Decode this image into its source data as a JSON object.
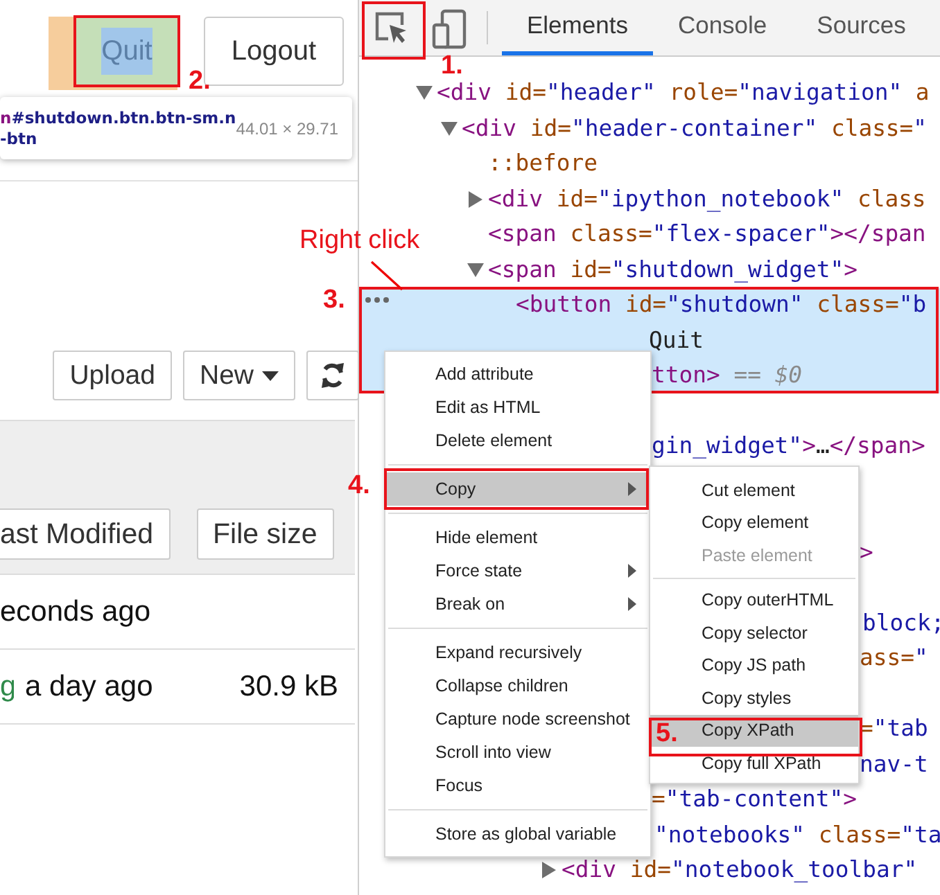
{
  "notebook": {
    "header_buttons": [
      {
        "label": "Quit",
        "inspected": true
      },
      {
        "label": "Logout",
        "inspected": false
      }
    ],
    "tooltip": {
      "tag": "n",
      "selector_lines": [
        "#shutdown.btn.btn-sm.n",
        "-btn"
      ],
      "size": "44.01 × 29.71"
    },
    "toolbar": [
      {
        "kind": "text",
        "label": "Upload"
      },
      {
        "kind": "dropdown",
        "label": "New"
      },
      {
        "kind": "refresh"
      }
    ],
    "list_header": [
      {
        "label": "ast Modified"
      },
      {
        "label": "File size"
      }
    ],
    "rows": [
      {
        "modified": "econds ago"
      },
      {
        "name": "g",
        "modified": "a day ago",
        "size": "30.9 kB"
      }
    ]
  },
  "devtools": {
    "tabs": [
      {
        "label": "Elements",
        "selected": true
      },
      {
        "label": "Console",
        "selected": false
      },
      {
        "label": "Sources",
        "selected": false
      }
    ],
    "lines": [
      {
        "expanded": true,
        "selected": false,
        "tokens": [
          {
            "kind": "tag",
            "text": "<div"
          },
          {
            "kind": "attr",
            "text": " id="
          },
          {
            "kind": "value",
            "text": "\"header\""
          },
          {
            "kind": "attr",
            "text": " role="
          },
          {
            "kind": "value",
            "text": "\"navigation\""
          },
          {
            "kind": "attr",
            "text": " a"
          }
        ]
      },
      {
        "expanded": true,
        "selected": false,
        "tokens": [
          {
            "kind": "tag",
            "text": "<div"
          },
          {
            "kind": "attr",
            "text": " id="
          },
          {
            "kind": "value",
            "text": "\"header-container\""
          },
          {
            "kind": "attr",
            "text": " class="
          },
          {
            "kind": "value",
            "text": "\""
          }
        ]
      },
      {
        "selected": false,
        "tokens": [
          {
            "kind": "pseudo",
            "text": "::before"
          }
        ]
      },
      {
        "expanded": false,
        "selected": false,
        "tokens": [
          {
            "kind": "tag",
            "text": "<div"
          },
          {
            "kind": "attr",
            "text": " id="
          },
          {
            "kind": "value",
            "text": "\"ipython_notebook\""
          },
          {
            "kind": "attr",
            "text": " class"
          }
        ]
      },
      {
        "selected": false,
        "tokens": [
          {
            "kind": "tag",
            "text": "<span"
          },
          {
            "kind": "attr",
            "text": " class="
          },
          {
            "kind": "value",
            "text": "\"flex-spacer\""
          },
          {
            "kind": "tag",
            "text": "></span"
          }
        ]
      },
      {
        "expanded": true,
        "selected": false,
        "tokens": [
          {
            "kind": "tag",
            "text": "<span"
          },
          {
            "kind": "attr",
            "text": " id="
          },
          {
            "kind": "value",
            "text": "\"shutdown_widget\""
          },
          {
            "kind": "tag",
            "text": ">"
          }
        ]
      },
      {
        "selected": true,
        "tokens": [
          {
            "kind": "tag",
            "text": "<button"
          },
          {
            "kind": "attr",
            "text": " id="
          },
          {
            "kind": "value",
            "text": "\"shutdown\""
          },
          {
            "kind": "attr",
            "text": " class="
          },
          {
            "kind": "value",
            "text": "\"b"
          }
        ]
      },
      {
        "selected": true,
        "tokens": [
          {
            "kind": "text",
            "text": "Quit"
          }
        ]
      },
      {
        "selected": true,
        "tokens": [
          {
            "kind": "tag",
            "text": "tton>"
          },
          {
            "kind": "hint",
            "text": " == $0"
          }
        ]
      },
      {
        "selected": false,
        "tokens": [
          {
            "kind": "value",
            "text": "gin_widget\""
          },
          {
            "kind": "tag",
            "text": ">"
          },
          {
            "kind": "text",
            "text": "…"
          },
          {
            "kind": "tag",
            "text": "</span>"
          }
        ]
      },
      {
        "selected": false,
        "tokens": [
          {
            "kind": "tag",
            "text": ">"
          }
        ]
      },
      {
        "selected": false,
        "tokens": [
          {
            "kind": "value",
            "text": "block;"
          }
        ]
      },
      {
        "selected": false,
        "tokens": [
          {
            "kind": "attr",
            "text": "ass="
          },
          {
            "kind": "value",
            "text": "\""
          }
        ]
      },
      {
        "selected": false,
        "tokens": [
          {
            "kind": "attr",
            "text": "="
          },
          {
            "kind": "value",
            "text": "\"tab"
          }
        ]
      },
      {
        "selected": false,
        "tokens": [
          {
            "kind": "value",
            "text": "nav-t"
          }
        ]
      },
      {
        "selected": false,
        "tokens": [
          {
            "kind": "attr",
            "text": "="
          },
          {
            "kind": "value",
            "text": "\"tab-content\""
          },
          {
            "kind": "tag",
            "text": ">"
          }
        ]
      },
      {
        "selected": false,
        "tokens": [
          {
            "kind": "value",
            "text": "\"notebooks\""
          },
          {
            "kind": "attr",
            "text": " class="
          },
          {
            "kind": "value",
            "text": "\"ta"
          }
        ]
      },
      {
        "expanded": false,
        "selected": false,
        "tokens": [
          {
            "kind": "tag",
            "text": "<div"
          },
          {
            "kind": "attr",
            "text": " id="
          },
          {
            "kind": "value",
            "text": "\"notebook_toolbar\""
          }
        ]
      }
    ],
    "context_menu": {
      "sections": [
        [
          {
            "label": "Add attribute",
            "submenu": false,
            "selected": false
          },
          {
            "label": "Edit as HTML",
            "submenu": false,
            "selected": false
          },
          {
            "label": "Delete element",
            "submenu": false,
            "selected": false
          }
        ],
        [
          {
            "label": "Copy",
            "submenu": true,
            "selected": true
          }
        ],
        [
          {
            "label": "Hide element",
            "submenu": false,
            "selected": false
          },
          {
            "label": "Force state",
            "submenu": true,
            "selected": false
          },
          {
            "label": "Break on",
            "submenu": true,
            "selected": false
          }
        ],
        [
          {
            "label": "Expand recursively",
            "submenu": false,
            "selected": false
          },
          {
            "label": "Collapse children",
            "submenu": false,
            "selected": false
          },
          {
            "label": "Capture node screenshot",
            "submenu": false,
            "selected": false
          },
          {
            "label": "Scroll into view",
            "submenu": false,
            "selected": false
          },
          {
            "label": "Focus",
            "submenu": false,
            "selected": false
          }
        ],
        [
          {
            "label": "Store as global variable",
            "submenu": false,
            "selected": false
          }
        ]
      ]
    },
    "submenu": {
      "sections": [
        [
          {
            "label": "Cut element",
            "disabled": false,
            "selected": false
          },
          {
            "label": "Copy element",
            "disabled": false,
            "selected": false
          },
          {
            "label": "Paste element",
            "disabled": true,
            "selected": false
          }
        ],
        [
          {
            "label": "Copy outerHTML",
            "disabled": false,
            "selected": false
          },
          {
            "label": "Copy selector",
            "disabled": false,
            "selected": false
          },
          {
            "label": "Copy JS path",
            "disabled": false,
            "selected": false
          },
          {
            "label": "Copy styles",
            "disabled": false,
            "selected": false
          },
          {
            "label": "Copy XPath",
            "disabled": false,
            "selected": true
          },
          {
            "label": "Copy full XPath",
            "disabled": false,
            "selected": false
          }
        ]
      ]
    }
  },
  "annotations": [
    {
      "text": "1."
    },
    {
      "text": "2."
    },
    {
      "text": "Right click"
    },
    {
      "text": "3."
    },
    {
      "text": "4."
    },
    {
      "text": "5."
    }
  ]
}
